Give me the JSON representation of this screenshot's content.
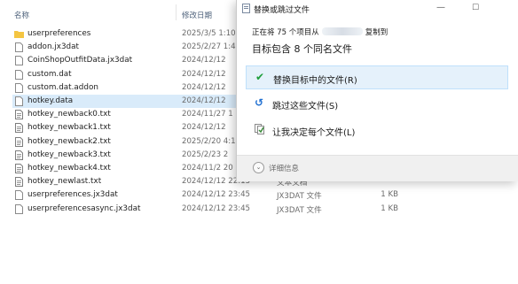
{
  "columns": {
    "name": "名称",
    "date_modified": "修改日期"
  },
  "files": [
    {
      "name": "userpreferences",
      "date": "2025/3/5 1:10",
      "type": "",
      "size": "",
      "icon": "folder-icon"
    },
    {
      "name": "addon.jx3dat",
      "date": "2025/2/27 1:4",
      "type": "",
      "size": "",
      "icon": "file-icon"
    },
    {
      "name": "CoinShopOutfitData.jx3dat",
      "date": "2024/12/12",
      "type": "",
      "size": "",
      "icon": "file-icon"
    },
    {
      "name": "custom.dat",
      "date": "2024/12/12",
      "type": "",
      "size": "",
      "icon": "file-icon"
    },
    {
      "name": "custom.dat.addon",
      "date": "2024/12/12",
      "type": "",
      "size": "",
      "icon": "file-icon"
    },
    {
      "name": "hotkey.data",
      "date": "2024/12/12",
      "type": "",
      "size": "",
      "icon": "file-icon"
    },
    {
      "name": "hotkey_newback0.txt",
      "date": "2024/11/27 1",
      "type": "",
      "size": "",
      "icon": "text-file-icon"
    },
    {
      "name": "hotkey_newback1.txt",
      "date": "2024/12/12",
      "type": "",
      "size": "",
      "icon": "text-file-icon"
    },
    {
      "name": "hotkey_newback2.txt",
      "date": "2025/2/20 4:1",
      "type": "",
      "size": "",
      "icon": "text-file-icon"
    },
    {
      "name": "hotkey_newback3.txt",
      "date": "2025/2/23 2",
      "type": "",
      "size": "",
      "icon": "text-file-icon"
    },
    {
      "name": "hotkey_newback4.txt",
      "date": "2024/11/2 20",
      "type": "",
      "size": "",
      "icon": "text-file-icon"
    },
    {
      "name": "hotkey_newlast.txt",
      "date": "2024/12/12 22:13",
      "type": "文本文档",
      "size": "",
      "icon": "text-file-icon"
    },
    {
      "name": "userpreferences.jx3dat",
      "date": "2024/12/12 23:45",
      "type": "JX3DAT 文件",
      "size": "1 KB",
      "icon": "file-icon"
    },
    {
      "name": "userpreferencesasync.jx3dat",
      "date": "2024/12/12 23:45",
      "type": "JX3DAT 文件",
      "size": "1 KB",
      "icon": "file-icon"
    }
  ],
  "dialog": {
    "title": "替换或跳过文件",
    "progress_prefix": "正在将 75 个项目从",
    "progress_suffix": "复制到",
    "heading": "目标包含 8 个同名文件",
    "options": [
      {
        "label": "替换目标中的文件(R)",
        "icon": "checkmark-icon",
        "color": "#1e9e3a"
      },
      {
        "label": "跳过这些文件(S)",
        "icon": "skip-icon",
        "color": "#1f6fd1"
      },
      {
        "label": "让我决定每个文件(L)",
        "icon": "decide-icon",
        "color": "#3a8b3a"
      }
    ],
    "details_label": "详细信息"
  },
  "colors": {
    "selection": "#d9ebfa",
    "option_hover": "#e5f1fb",
    "folder": "#f4c542"
  }
}
